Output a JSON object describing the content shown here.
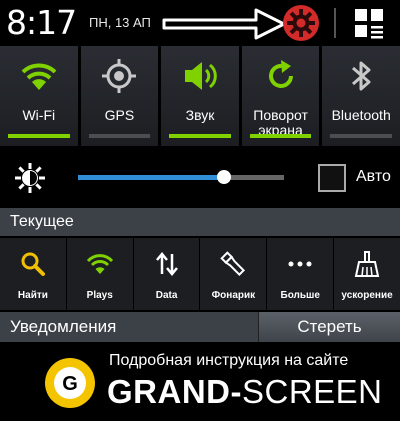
{
  "status_bar": {
    "time": "8:17",
    "date": "ПН, 13 АП",
    "settings_icon": "gear-icon",
    "grid_icon": "grid-edit-icon"
  },
  "toggles": [
    {
      "id": "wifi",
      "label": "Wi-Fi",
      "icon": "wifi-icon",
      "active": true
    },
    {
      "id": "gps",
      "label": "GPS",
      "icon": "gps-icon",
      "active": false
    },
    {
      "id": "sound",
      "label": "Звук",
      "icon": "speaker-icon",
      "active": true
    },
    {
      "id": "rotation",
      "label": "Поворот экрана",
      "icon": "rotate-icon",
      "active": true
    },
    {
      "id": "bluetooth",
      "label": "Bluetooth",
      "icon": "bluetooth-icon",
      "active": false
    }
  ],
  "brightness": {
    "level": 0.71,
    "auto_label": "Авто",
    "auto_checked": false
  },
  "current": {
    "title": "Текущее",
    "apps": [
      {
        "label": "Найти",
        "icon": "search-icon"
      },
      {
        "label": "Plays",
        "icon": "wifi-icon"
      },
      {
        "label": "Data",
        "icon": "data-arrows-icon"
      },
      {
        "label": "Фонарик",
        "icon": "flashlight-icon"
      },
      {
        "label": "Больше",
        "icon": "more-icon"
      },
      {
        "label": "ускорение",
        "icon": "broom-icon"
      }
    ]
  },
  "notifications": {
    "title": "Уведомления",
    "clear_label": "Стереть"
  },
  "banner": {
    "subtitle": "Подробная инструкция на сайте",
    "logo_letter": "G",
    "title_bold": "GRAND-",
    "title_rest": "SCREEN"
  },
  "colors": {
    "accent_green": "#7fd100",
    "slider_blue": "#2f8ed6",
    "gear_red": "#d32a2a",
    "logo_yellow": "#f5c400"
  }
}
